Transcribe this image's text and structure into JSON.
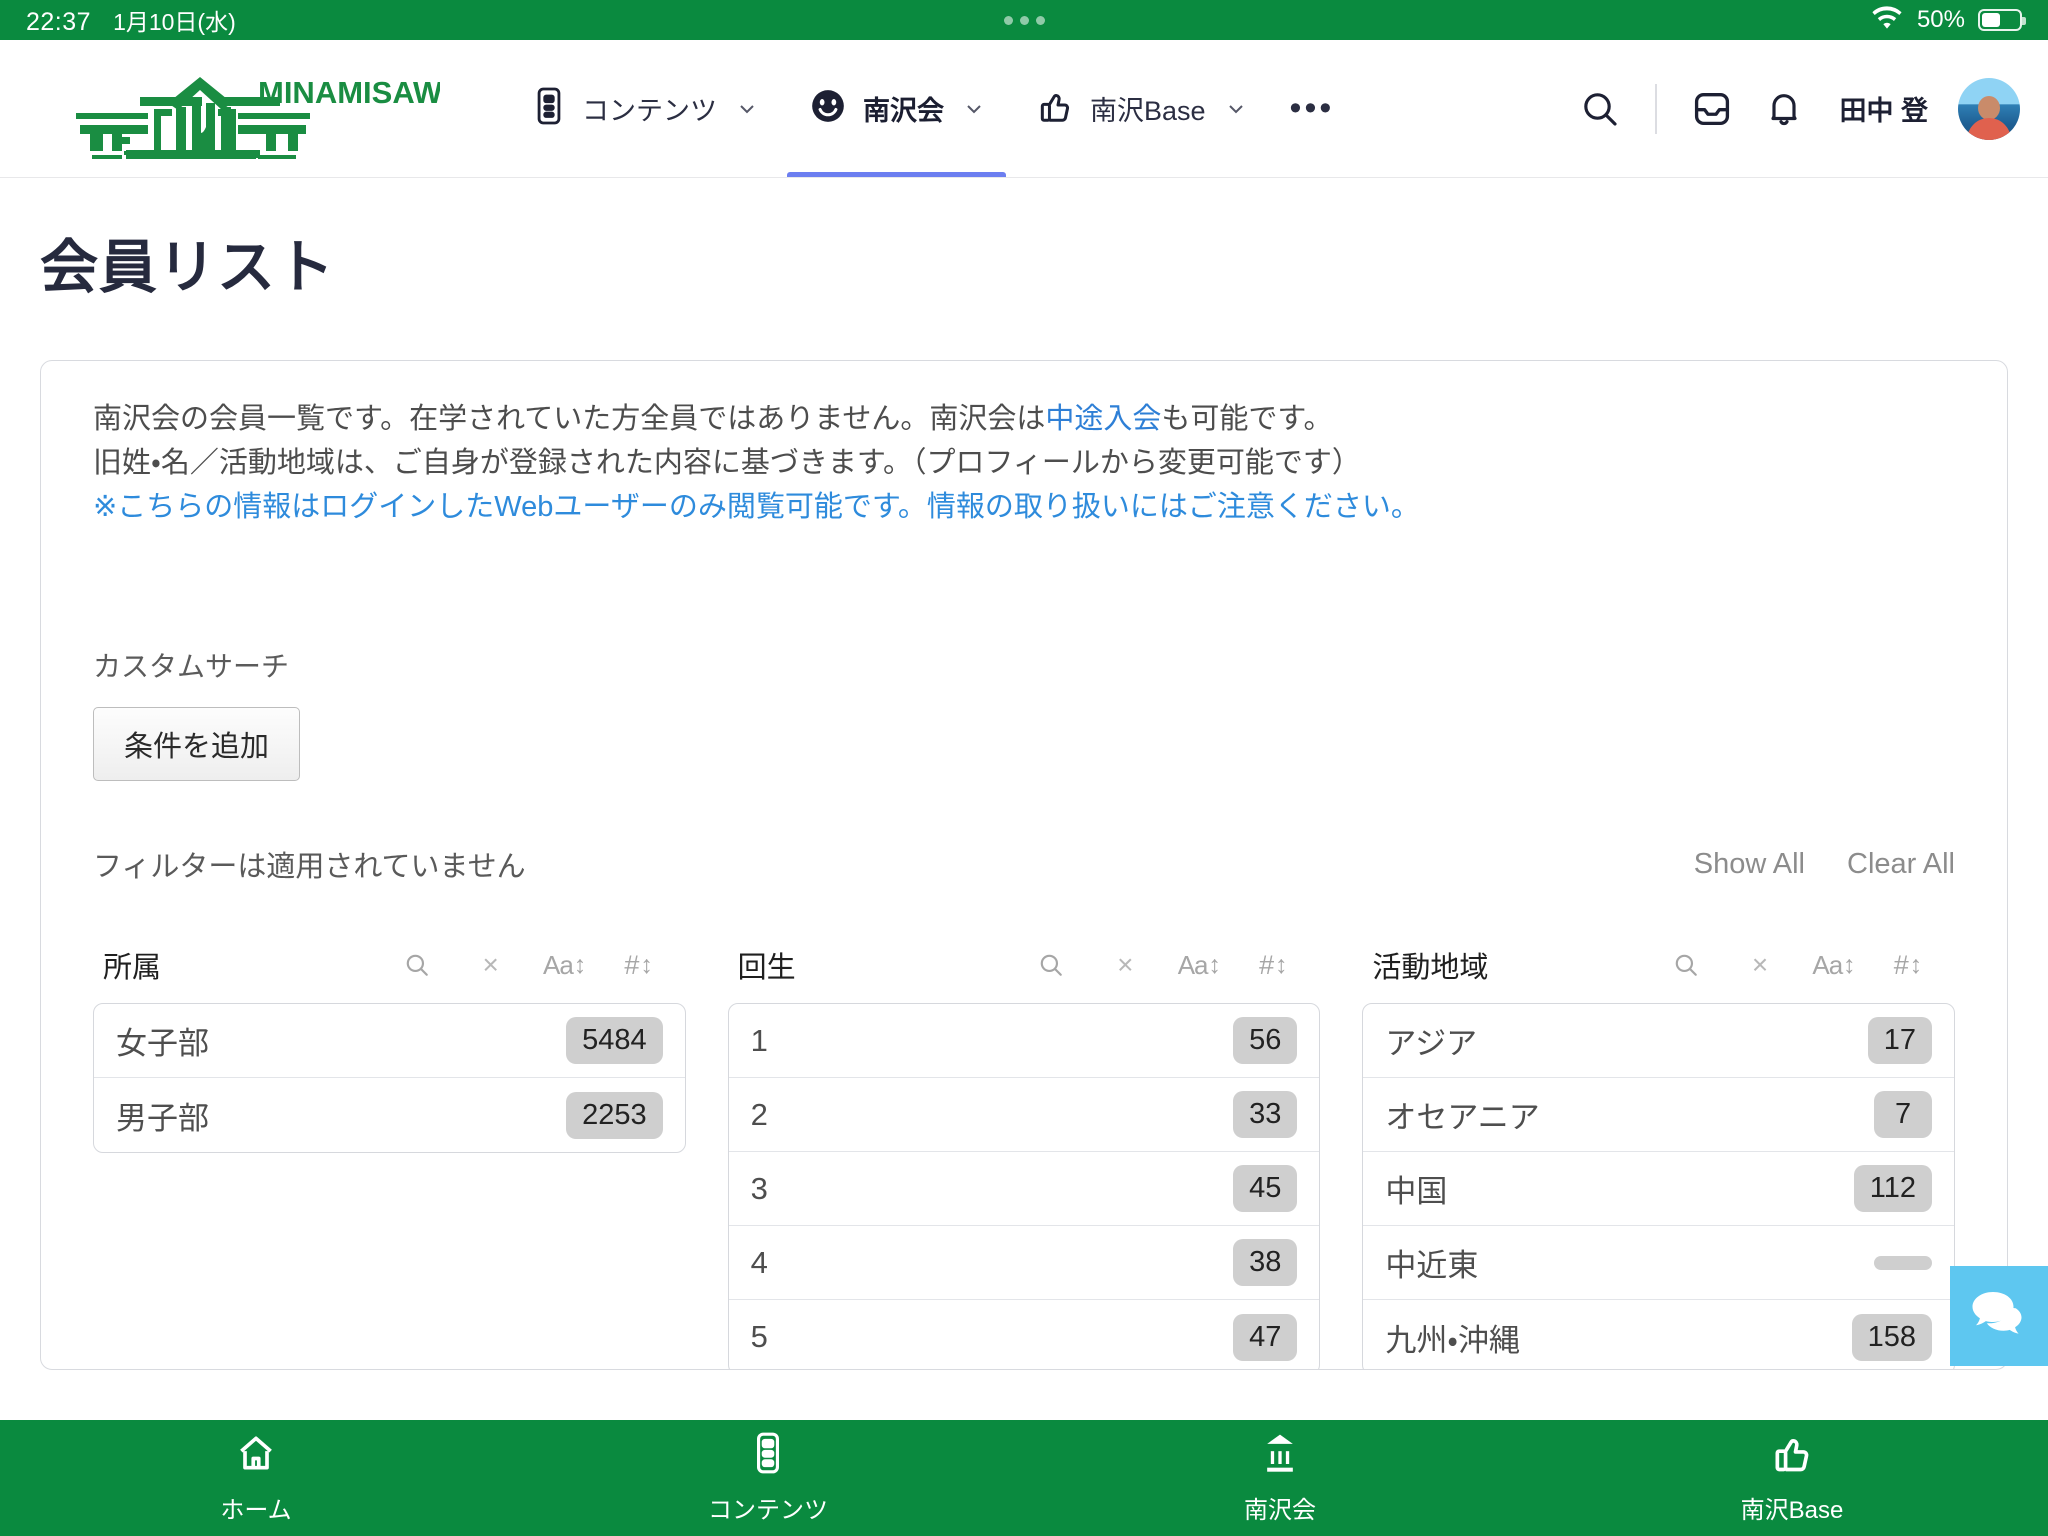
{
  "statusbar": {
    "time": "22:37",
    "date": "1月10日(水)",
    "battery_percent": "50%"
  },
  "header": {
    "logo_text": "MINAMISAWA",
    "nav": [
      {
        "label": "コンテンツ",
        "icon": "document-icon",
        "active": false,
        "has_chevron": true
      },
      {
        "label": "南沢会",
        "icon": "smiley-face-icon",
        "active": true,
        "has_chevron": true
      },
      {
        "label": "南沢Base",
        "icon": "thumbs-up-icon",
        "active": false,
        "has_chevron": true
      }
    ],
    "more_label": "•••",
    "icons": [
      "search-icon",
      "inbox-icon",
      "bell-icon"
    ],
    "username": "田中 登"
  },
  "page": {
    "title": "会員リスト"
  },
  "description": {
    "line1_before": "南沢会の会員一覧です。在学されていた方全員ではありません。南沢会は",
    "line1_link": "中途入会",
    "line1_after": "も可能です。",
    "line2": "旧姓・名／活動地域は、ご自身が登録された内容に基づきます。（プロフィールから変更可能です）",
    "line3": "※こちらの情報はログインしたWebユーザーのみ閲覧可能です。情報の取り扱いにはご注意ください。"
  },
  "custom_search": {
    "label": "カスタムサーチ",
    "add_button": "条件を追加"
  },
  "filter_bar": {
    "status": "フィルターは適用されていません",
    "show_all": "Show All",
    "clear_all": "Clear All"
  },
  "facet_tools": {
    "search": "search-icon",
    "clear": "×",
    "sort_alpha_label": "Aa",
    "sort_alpha_arrows": "↕",
    "sort_num_label": "#",
    "sort_num_arrows": "↕"
  },
  "facets": [
    {
      "title": "所属",
      "items": [
        {
          "label": "女子部",
          "count": "5484"
        },
        {
          "label": "男子部",
          "count": "2253"
        }
      ]
    },
    {
      "title": "回生",
      "items": [
        {
          "label": "1",
          "count": "56"
        },
        {
          "label": "2",
          "count": "33"
        },
        {
          "label": "3",
          "count": "45"
        },
        {
          "label": "4",
          "count": "38"
        },
        {
          "label": "5",
          "count": "47"
        }
      ]
    },
    {
      "title": "活動地域",
      "items": [
        {
          "label": "アジア",
          "count": "17"
        },
        {
          "label": "オセアニア",
          "count": "7"
        },
        {
          "label": "中国",
          "count": "112"
        },
        {
          "label": "中近東",
          "count": ""
        },
        {
          "label": "九州・沖縄",
          "count": "158"
        }
      ]
    }
  ],
  "chat_widget": {
    "icon": "chat-bubbles-icon"
  },
  "tabbar": [
    {
      "label": "ホーム",
      "icon": "home-icon"
    },
    {
      "label": "コンテンツ",
      "icon": "document-icon"
    },
    {
      "label": "南沢会",
      "icon": "bank-icon"
    },
    {
      "label": "南沢Base",
      "icon": "thumbs-up-icon"
    }
  ],
  "colors": {
    "brand_green": "#0a8a3f",
    "accent_blue": "#6c7ef0",
    "link_blue": "#2e7fd6",
    "chat_blue": "#5ec7f0"
  }
}
